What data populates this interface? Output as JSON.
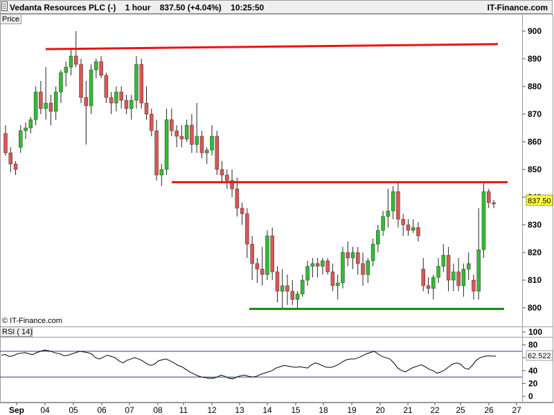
{
  "header": {
    "instrument": "Vedanta Resources PLC (-)",
    "timeframe": "1 hour",
    "last": "837.50 (+4.04%)",
    "time": "10:25:50",
    "brand": "IT-Finance.com"
  },
  "price_panel": {
    "label": "Price",
    "watermark": "© IT-Finance.com",
    "last_price_tag": "837.50"
  },
  "rsi_panel": {
    "label": "RSI ( 14)",
    "last_value_tag": "62.522"
  },
  "colors": {
    "up": "#33bb33",
    "down": "#dd5555",
    "resistance": "#ee1111",
    "support": "#118811",
    "rsi_line": "#000000",
    "rsi_overbought_fill": "#3333cc",
    "rsi_oversold_fill": "#44aa44",
    "price_tag_bg": "#ffff44"
  },
  "chart_data": [
    {
      "type": "candlestick",
      "title": "Vedanta Resources PLC (-) 1 hour",
      "ylim": [
        800,
        900
      ],
      "y_ticks": [
        "900",
        "890",
        "880",
        "870",
        "860",
        "850",
        "840",
        "830",
        "820",
        "810",
        "800"
      ],
      "x_ticks": [
        "Sep",
        "04",
        "05",
        "06",
        "07",
        "08",
        "11",
        "12",
        "13",
        "14",
        "15",
        "18",
        "19",
        "20",
        "21",
        "22",
        "25",
        "26",
        "27"
      ],
      "grid": false,
      "ohlc": [
        [
          863,
          866,
          855,
          856
        ],
        [
          856,
          858,
          849,
          852
        ],
        [
          852,
          853,
          848,
          850
        ],
        [
          858,
          866,
          856,
          864
        ],
        [
          864,
          867,
          861,
          865
        ],
        [
          865,
          869,
          863,
          868
        ],
        [
          868,
          880,
          866,
          878
        ],
        [
          878,
          882,
          870,
          872
        ],
        [
          872,
          887,
          868,
          874
        ],
        [
          874,
          877,
          866,
          871
        ],
        [
          871,
          880,
          868,
          878
        ],
        [
          878,
          886,
          874,
          885
        ],
        [
          885,
          889,
          880,
          887
        ],
        [
          887,
          894,
          884,
          891
        ],
        [
          891,
          900,
          887,
          888
        ],
        [
          888,
          890,
          874,
          876
        ],
        [
          876,
          882,
          859,
          873
        ],
        [
          873,
          888,
          870,
          886
        ],
        [
          886,
          890,
          883,
          889
        ],
        [
          889,
          891,
          883,
          884
        ],
        [
          884,
          885,
          874,
          876
        ],
        [
          876,
          878,
          870,
          874
        ],
        [
          874,
          880,
          871,
          878
        ],
        [
          878,
          880,
          872,
          875
        ],
        [
          875,
          877,
          870,
          872
        ],
        [
          872,
          877,
          868,
          875
        ],
        [
          875,
          891,
          872,
          888
        ],
        [
          888,
          890,
          872,
          874
        ],
        [
          874,
          880,
          868,
          870
        ],
        [
          870,
          872,
          862,
          864
        ],
        [
          864,
          868,
          846,
          848
        ],
        [
          848,
          852,
          844,
          850
        ],
        [
          850,
          872,
          848,
          868
        ],
        [
          868,
          872,
          862,
          864
        ],
        [
          864,
          866,
          858,
          862
        ],
        [
          862,
          866,
          858,
          861
        ],
        [
          861,
          868,
          860,
          866
        ],
        [
          866,
          870,
          856,
          859
        ],
        [
          859,
          874,
          856,
          862
        ],
        [
          862,
          864,
          854,
          856
        ],
        [
          856,
          858,
          852,
          857
        ],
        [
          857,
          866,
          855,
          862
        ],
        [
          862,
          864,
          848,
          850
        ],
        [
          850,
          853,
          845,
          848
        ],
        [
          848,
          850,
          843,
          846
        ],
        [
          846,
          850,
          840,
          843
        ],
        [
          843,
          847,
          833,
          836
        ],
        [
          836,
          838,
          830,
          834
        ],
        [
          834,
          836,
          818,
          823
        ],
        [
          823,
          826,
          810,
          816
        ],
        [
          816,
          818,
          809,
          814
        ],
        [
          814,
          822,
          808,
          812
        ],
        [
          812,
          828,
          810,
          826
        ],
        [
          826,
          829,
          810,
          813
        ],
        [
          813,
          815,
          802,
          806
        ],
        [
          806,
          814,
          800,
          808
        ],
        [
          808,
          812,
          801,
          806
        ],
        [
          806,
          810,
          801,
          803
        ],
        [
          803,
          806,
          800,
          805
        ],
        [
          805,
          812,
          804,
          810
        ],
        [
          810,
          817,
          808,
          815
        ],
        [
          815,
          818,
          811,
          816
        ],
        [
          816,
          818,
          811,
          815
        ],
        [
          815,
          818,
          812,
          817
        ],
        [
          817,
          818,
          812,
          813
        ],
        [
          813,
          816,
          806,
          808
        ],
        [
          808,
          812,
          803,
          809
        ],
        [
          809,
          822,
          807,
          820
        ],
        [
          820,
          824,
          815,
          818
        ],
        [
          818,
          822,
          814,
          820
        ],
        [
          820,
          822,
          812,
          816
        ],
        [
          816,
          820,
          808,
          812
        ],
        [
          812,
          818,
          809,
          817
        ],
        [
          817,
          825,
          815,
          823
        ],
        [
          823,
          830,
          820,
          828
        ],
        [
          828,
          835,
          826,
          833
        ],
        [
          833,
          843,
          829,
          835
        ],
        [
          835,
          844,
          832,
          842
        ],
        [
          842,
          845,
          829,
          832
        ],
        [
          832,
          834,
          826,
          830
        ],
        [
          830,
          832,
          826,
          828
        ],
        [
          828,
          832,
          827,
          829
        ],
        [
          829,
          831,
          824,
          826
        ],
        [
          814,
          818,
          806,
          808
        ],
        [
          808,
          811,
          805,
          807
        ],
        [
          807,
          812,
          803,
          811
        ],
        [
          811,
          818,
          809,
          815
        ],
        [
          815,
          823,
          813,
          819
        ],
        [
          819,
          822,
          806,
          810
        ],
        [
          810,
          816,
          806,
          813
        ],
        [
          813,
          818,
          806,
          808
        ],
        [
          808,
          816,
          804,
          814
        ],
        [
          814,
          820,
          810,
          816
        ],
        [
          810,
          812,
          803,
          806
        ],
        [
          806,
          836,
          803,
          821
        ],
        [
          821,
          845,
          818,
          842
        ],
        [
          842,
          843,
          836,
          838
        ],
        [
          838,
          839,
          836,
          837.5
        ]
      ],
      "resistance_lines": [
        {
          "from_value": 893.5,
          "to_value": 895.3
        },
        {
          "from_value": 845.4,
          "to_value": 845.4
        }
      ],
      "support_lines": [
        {
          "from_value": 799.6,
          "to_value": 799.6
        }
      ]
    },
    {
      "type": "line",
      "title": "RSI ( 14)",
      "ylim": [
        0,
        100
      ],
      "y_ticks": [
        "100",
        "80",
        "60",
        "40",
        "20",
        "0"
      ],
      "overbought": 70,
      "oversold": 30,
      "values": [
        64,
        65,
        62,
        63,
        66,
        67,
        68,
        66,
        65,
        68,
        70,
        72,
        71,
        69,
        67,
        66,
        63,
        64,
        66,
        68,
        70,
        69,
        68,
        66,
        60,
        58,
        61,
        64,
        62,
        60,
        55,
        52,
        56,
        58,
        60,
        58,
        55,
        51,
        48,
        50,
        55,
        57,
        58,
        55,
        52,
        48,
        46,
        42,
        38,
        35,
        32,
        30,
        29,
        28,
        28,
        30,
        33,
        31,
        28,
        27,
        30,
        32,
        33,
        31,
        30,
        31,
        34,
        36,
        38,
        40,
        44,
        46,
        48,
        47,
        46,
        45,
        46,
        45,
        44,
        49,
        52,
        50,
        47,
        45,
        45,
        47,
        50,
        54,
        57,
        58,
        58,
        60,
        63,
        66,
        68,
        70,
        66,
        62,
        60,
        58,
        52,
        44,
        40,
        38,
        42,
        45,
        47,
        49,
        46,
        42,
        40,
        36,
        38,
        41,
        46,
        50,
        52,
        50,
        44,
        42,
        48,
        56,
        60,
        62,
        63,
        62.5,
        62.522
      ]
    }
  ]
}
